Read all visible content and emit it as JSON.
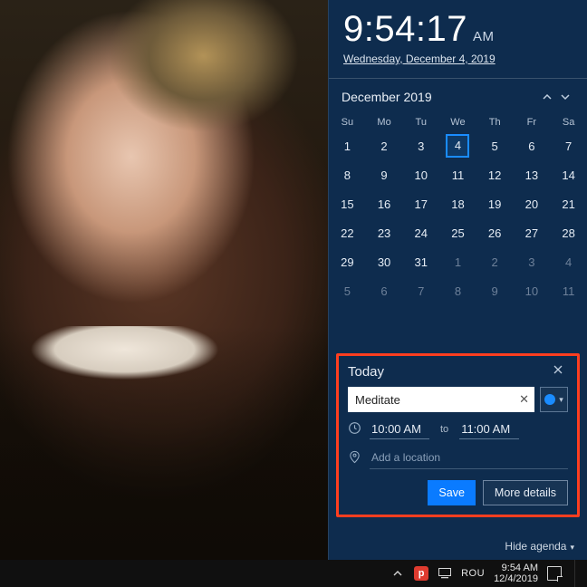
{
  "clock": {
    "time": "9:54:17",
    "ampm": "AM",
    "date": "Wednesday, December 4, 2019"
  },
  "calendar": {
    "month_label": "December 2019",
    "dow": [
      "Su",
      "Mo",
      "Tu",
      "We",
      "Th",
      "Fr",
      "Sa"
    ],
    "weeks": [
      [
        {
          "d": 1
        },
        {
          "d": 2
        },
        {
          "d": 3
        },
        {
          "d": 4,
          "today": true
        },
        {
          "d": 5
        },
        {
          "d": 6
        },
        {
          "d": 7
        }
      ],
      [
        {
          "d": 8
        },
        {
          "d": 9
        },
        {
          "d": 10
        },
        {
          "d": 11
        },
        {
          "d": 12
        },
        {
          "d": 13
        },
        {
          "d": 14
        }
      ],
      [
        {
          "d": 15
        },
        {
          "d": 16
        },
        {
          "d": 17
        },
        {
          "d": 18
        },
        {
          "d": 19
        },
        {
          "d": 20
        },
        {
          "d": 21
        }
      ],
      [
        {
          "d": 22
        },
        {
          "d": 23
        },
        {
          "d": 24
        },
        {
          "d": 25
        },
        {
          "d": 26
        },
        {
          "d": 27
        },
        {
          "d": 28
        }
      ],
      [
        {
          "d": 29
        },
        {
          "d": 30
        },
        {
          "d": 31
        },
        {
          "d": 1,
          "dim": true
        },
        {
          "d": 2,
          "dim": true
        },
        {
          "d": 3,
          "dim": true
        },
        {
          "d": 4,
          "dim": true
        }
      ],
      [
        {
          "d": 5,
          "dim": true
        },
        {
          "d": 6,
          "dim": true
        },
        {
          "d": 7,
          "dim": true
        },
        {
          "d": 8,
          "dim": true
        },
        {
          "d": 9,
          "dim": true
        },
        {
          "d": 10,
          "dim": true
        },
        {
          "d": 11,
          "dim": true
        }
      ]
    ]
  },
  "agenda": {
    "header": "Today",
    "event_title": "Meditate",
    "start_time": "10:00 AM",
    "to_label": "to",
    "end_time": "11:00 AM",
    "location_placeholder": "Add a location",
    "save_label": "Save",
    "more_label": "More details",
    "calendar_color": "#1a8cff"
  },
  "hide_agenda_label": "Hide agenda",
  "taskbar": {
    "lang": "ROU",
    "time": "9:54 AM",
    "date": "12/4/2019"
  }
}
